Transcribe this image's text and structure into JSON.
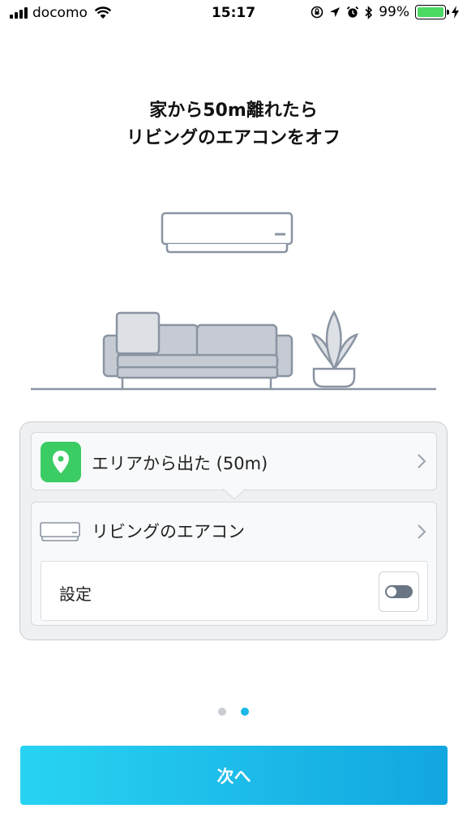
{
  "status_bar": {
    "carrier": "docomo",
    "time": "15:17",
    "battery_percent": "99%",
    "battery_level": 0.99,
    "icons": [
      "signal-icon",
      "wifi-icon",
      "rotation-lock-icon",
      "location-icon",
      "alarm-icon",
      "bluetooth-icon",
      "battery-icon",
      "charging-icon"
    ]
  },
  "title": {
    "line1": "家から50m離れたら",
    "line2": "リビングのエアコンをオフ"
  },
  "illustration": {
    "icons": [
      "air-conditioner-icon",
      "sofa-icon",
      "plant-icon"
    ]
  },
  "card": {
    "trigger": {
      "icon": "location-pin-icon",
      "label": "エリアから出た (50m)",
      "accent": "#3ccc64"
    },
    "action": {
      "icon": "air-conditioner-icon",
      "label": "リビングのエアコン",
      "setting_label": "設定",
      "toggle_on": false
    }
  },
  "pager": {
    "page_count": 2,
    "current_page": 2,
    "active_color": "#1ab8e8"
  },
  "next_button": {
    "label": "次へ",
    "colors": [
      "#28d3f2",
      "#12a6e0"
    ]
  }
}
